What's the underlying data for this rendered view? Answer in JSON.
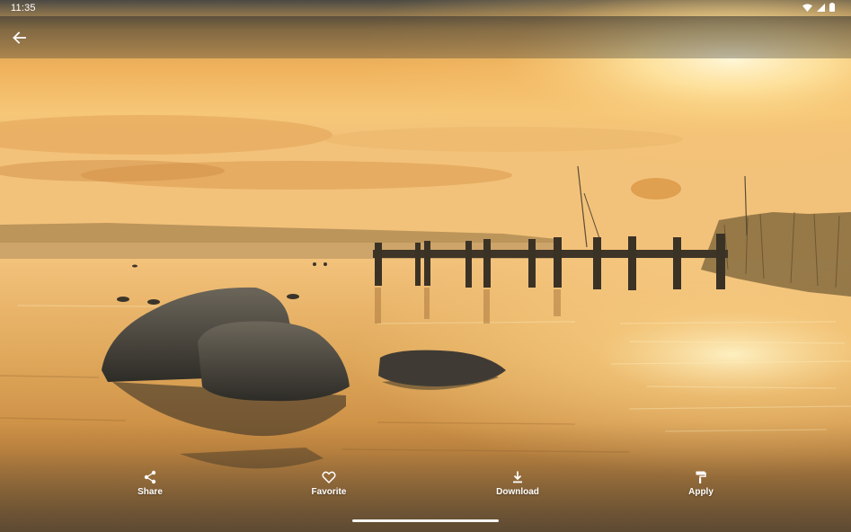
{
  "status_bar": {
    "time": "11:35",
    "icons": [
      "wifi-icon",
      "cellular-signal-icon",
      "battery-icon"
    ]
  },
  "top_bar": {
    "back_icon": "arrow-left-icon"
  },
  "wallpaper": {
    "subject": "golden-sunrise-lake-jetty-rocks"
  },
  "actions": [
    {
      "id": "share",
      "label": "Share",
      "icon": "share-icon"
    },
    {
      "id": "favorite",
      "label": "Favorite",
      "icon": "heart-outline-icon"
    },
    {
      "id": "download",
      "label": "Download",
      "icon": "download-icon"
    },
    {
      "id": "apply",
      "label": "Apply",
      "icon": "paint-roller-icon"
    }
  ],
  "colors": {
    "sky_top": "#d89b4a",
    "sun": "#fff3c8",
    "water": "#d79a4a",
    "rock": "#3d3b35",
    "bar_overlay": "#3a3935"
  }
}
